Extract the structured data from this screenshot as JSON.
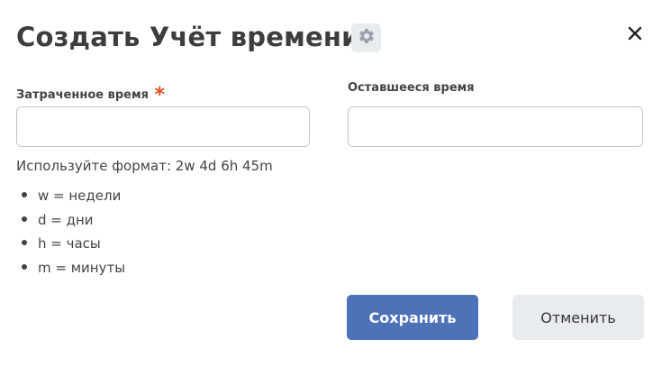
{
  "dialog": {
    "title": "Создать Учёт времени",
    "settings_icon": "gear-icon",
    "close_icon": "close-icon"
  },
  "fields": {
    "time_spent": {
      "label": "Затраченное время",
      "required_mark": "*",
      "value": "",
      "placeholder": ""
    },
    "time_remaining": {
      "label": "Оставшееся время",
      "value": "",
      "placeholder": ""
    }
  },
  "help": {
    "format_hint": "Используйте формат: 2w 4d 6h 45m",
    "units": [
      "w = недели",
      "d = дни",
      "h = часы",
      "m = минуты"
    ]
  },
  "buttons": {
    "save": "Сохранить",
    "cancel": "Отменить"
  },
  "colors": {
    "primary": "#4e72b8",
    "required": "#e2501f",
    "secondary_button": "#e9ecee"
  }
}
